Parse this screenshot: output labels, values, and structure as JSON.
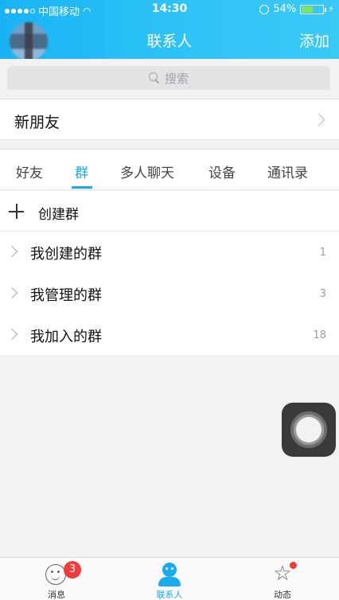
{
  "status_bar": {
    "carrier": "中国移动",
    "time": "14:30",
    "battery": "54%",
    "battery_level": 0.54
  },
  "header": {
    "title": "联系人",
    "action_label": "添加"
  },
  "search": {
    "placeholder": "搜索"
  },
  "new_friends": {
    "label": "新朋友"
  },
  "tabs": [
    {
      "label": "好友",
      "active": false
    },
    {
      "label": "群",
      "active": true
    },
    {
      "label": "多人聊天",
      "active": false
    },
    {
      "label": "设备",
      "active": false
    },
    {
      "label": "通讯录",
      "active": false
    }
  ],
  "create_group": {
    "label": "创建群"
  },
  "groups": [
    {
      "name": "我创建的群",
      "count": "1"
    },
    {
      "name": "我管理的群",
      "count": "3"
    },
    {
      "name": "我加入的群",
      "count": "18"
    }
  ],
  "tab_bar": {
    "items": [
      {
        "label": "消息",
        "icon": "message-icon",
        "badge": "3"
      },
      {
        "label": "联系人",
        "icon": "contacts-icon",
        "active": true
      },
      {
        "label": "动态",
        "icon": "star-icon",
        "dot": true
      }
    ]
  },
  "colors": {
    "accent": "#19aaf0",
    "badge": "#f43b3b",
    "header_start": "#19b3f5",
    "header_end": "#3ac9f5"
  }
}
